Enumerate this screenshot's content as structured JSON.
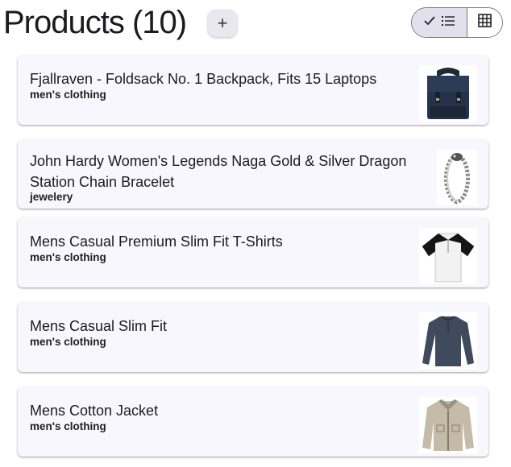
{
  "header": {
    "title": "Products (10)",
    "add_label": "+"
  },
  "view_toggle": {
    "list_selected": true,
    "options": [
      "list-view",
      "grid-view"
    ]
  },
  "products": [
    {
      "name": "Fjallraven - Foldsack No. 1 Backpack, Fits 15 Laptops",
      "category": "men's clothing",
      "image_icon": "backpack-icon"
    },
    {
      "name": "John Hardy Women's Legends Naga Gold & Silver Dragon Station Chain Bracelet",
      "category": "jewelery",
      "image_icon": "bracelet-icon"
    },
    {
      "name": "Mens Casual Premium Slim Fit T-Shirts",
      "category": "men's clothing",
      "image_icon": "tshirt-icon"
    },
    {
      "name": "Mens Casual Slim Fit",
      "category": "men's clothing",
      "image_icon": "longsleeve-shirt-icon"
    },
    {
      "name": "Mens Cotton Jacket",
      "category": "men's clothing",
      "image_icon": "jacket-icon"
    }
  ],
  "colors": {
    "card_bg": "#f8f7fd",
    "toggle_selected_bg": "#e2e0ec",
    "add_button_bg": "#e9e7ef"
  }
}
